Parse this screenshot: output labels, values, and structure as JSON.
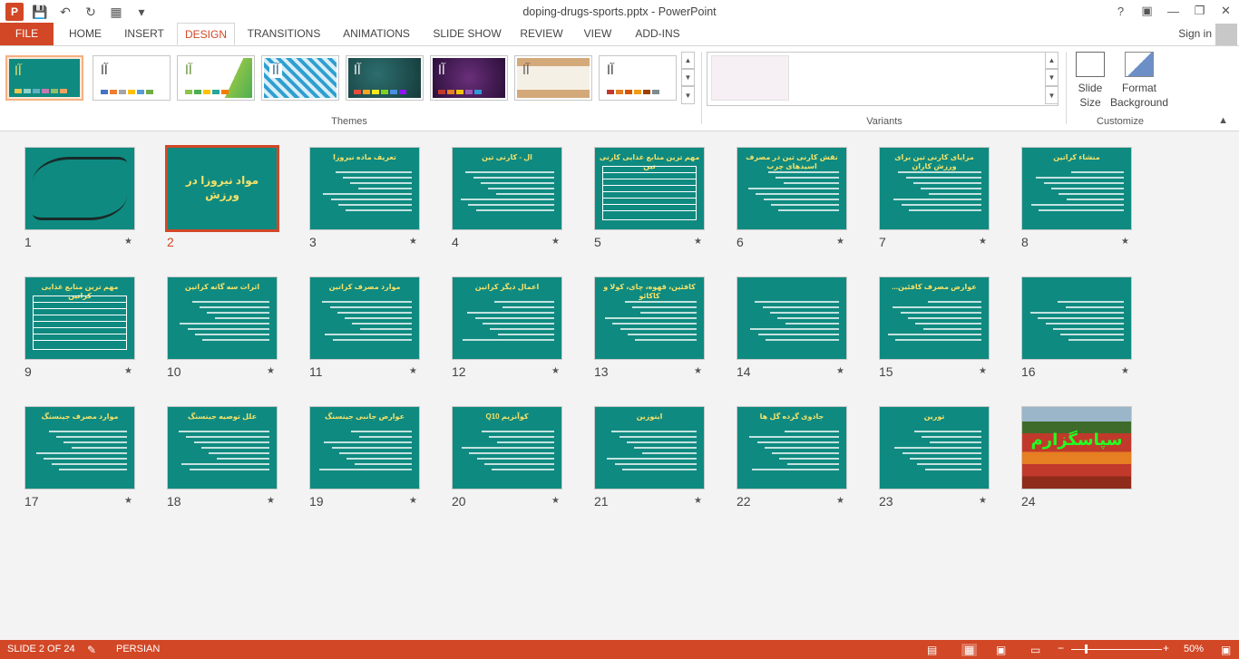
{
  "app": {
    "title": "doping-drugs-sports.pptx - PowerPoint",
    "logo_letter": "P"
  },
  "tabs": [
    {
      "label": "FILE"
    },
    {
      "label": "HOME"
    },
    {
      "label": "INSERT"
    },
    {
      "label": "DESIGN"
    },
    {
      "label": "TRANSITIONS"
    },
    {
      "label": "ANIMATIONS"
    },
    {
      "label": "SLIDE SHOW"
    },
    {
      "label": "REVIEW"
    },
    {
      "label": "VIEW"
    },
    {
      "label": "ADD-INS"
    }
  ],
  "active_tab": "DESIGN",
  "account": {
    "signin": "Sign in"
  },
  "ribbon": {
    "themes_label": "Themes",
    "variants_label": "Variants",
    "customize_label": "Customize",
    "theme_sample": "آا",
    "slide_size_line1": "Slide",
    "slide_size_line2": "Size",
    "format_bg_line1": "Format",
    "format_bg_line2": "Background"
  },
  "slides": [
    {
      "num": "1",
      "title": ""
    },
    {
      "num": "2",
      "title": "مواد نیروزا در ورزش"
    },
    {
      "num": "3",
      "title": "تعریف ماده نیروزا"
    },
    {
      "num": "4",
      "title": "ال - کارنی تین"
    },
    {
      "num": "5",
      "title": "مهم ترین منابع غذایی کارنی تین"
    },
    {
      "num": "6",
      "title": "نقش کارنی تین در مصرف اسیدهای چرب"
    },
    {
      "num": "7",
      "title": "مزایای کارنی تین برای ورزش کاران"
    },
    {
      "num": "8",
      "title": "منشاء کراتین"
    },
    {
      "num": "9",
      "title": "مهم ترین منابع غذایی کراتین"
    },
    {
      "num": "10",
      "title": "اثرات سه گانه کراتین"
    },
    {
      "num": "11",
      "title": "موارد مصرف کراتین"
    },
    {
      "num": "12",
      "title": "اعمال دیگر کراتین"
    },
    {
      "num": "13",
      "title": "کافئین، قهوه، چای، کولا و کاکائو"
    },
    {
      "num": "14",
      "title": ""
    },
    {
      "num": "15",
      "title": "عوارض مصرف کافئین..."
    },
    {
      "num": "16",
      "title": ""
    },
    {
      "num": "17",
      "title": "موارد مصرف جینسنگ"
    },
    {
      "num": "18",
      "title": "علل توصیه جینسنگ"
    },
    {
      "num": "19",
      "title": "عوارض جانبی جینسنگ"
    },
    {
      "num": "20",
      "title": "کوآنزیم Q10"
    },
    {
      "num": "21",
      "title": "اینوزین"
    },
    {
      "num": "22",
      "title": "جادوی گرده گل ها"
    },
    {
      "num": "23",
      "title": "تورین"
    },
    {
      "num": "24",
      "title": "سپاسگزارم"
    }
  ],
  "selected_slide": "2",
  "status": {
    "slide_info": "SLIDE 2 OF 24",
    "language": "PERSIAN",
    "zoom": "50%"
  },
  "colors": {
    "accent": "#d24726",
    "slide_bg": "#0f8a80",
    "slide_title": "#f4e26b",
    "sorter_bg": "#f3f3f3"
  }
}
